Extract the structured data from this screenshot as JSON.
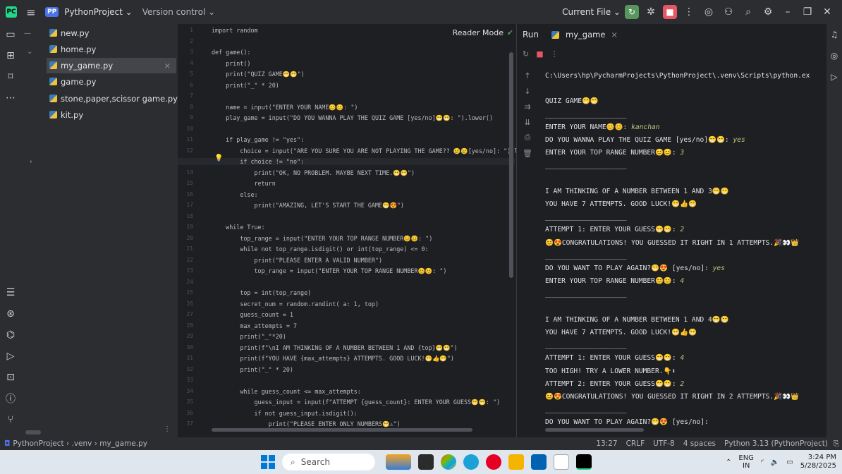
{
  "titlebar": {
    "project_badge": "PP",
    "project_name": "PythonProject ⌄",
    "vcs": "Version control ⌄",
    "run_config": "Current File ⌄"
  },
  "project_tree": [
    {
      "label": "new.py"
    },
    {
      "label": "home.py"
    },
    {
      "label": "my_game.py"
    },
    {
      "label": "game.py"
    },
    {
      "label": "stone,paper,scissor game.py"
    },
    {
      "label": "kit.py"
    }
  ],
  "editor": {
    "reader_mode": "Reader Mode",
    "lines": [
      "import random",
      "",
      "def game():",
      "    print()",
      "    print(\"QUIZ GAME😁😁\")",
      "    print(\"_\" * 20)",
      "",
      "    name = input(\"ENTER YOUR NAME😊😊: \")",
      "    play_game = input(\"DO YOU WANNA PLAY THE QUIZ GAME [yes/no]😁😁: \").lower()",
      "",
      "    if play_game != \"yes\":",
      "        choice = input(\"ARE YOU SURE YOU ARE NOT PLAYING THE GAME?? 😢😢[yes/no]: \").l",
      "        if choice != \"no\":",
      "            print(\"OK, NO PROBLEM. MAYBE NEXT TIME.😁😁\")",
      "            return",
      "        else:",
      "            print(\"AMAZING, LET'S START THE GAME😁😍\")",
      "",
      "    while True:",
      "        top_range = input(\"ENTER YOUR TOP RANGE NUMBER😊😊: \")",
      "        while not top_range.isdigit() or int(top_range) <= 0:",
      "            print(\"PLEASE ENTER A VALID NUMBER\")",
      "            top_range = input(\"ENTER YOUR TOP RANGE NUMBER😊😊: \")",
      "",
      "        top = int(top_range)",
      "        secret_num = random.randint( a: 1, top)",
      "        guess_count = 1",
      "        max_attempts = 7",
      "        print(\"_\"*20)",
      "        print(f\"\\nI AM THINKING OF A NUMBER BETWEEN 1 AND {top}😁😁\")",
      "        print(f\"YOU HAVE {max_attempts} ATTEMPTS. GOOD LUCK!😁👍😁\")",
      "        print(\"_\" * 20)",
      "",
      "        while guess_count <= max_attempts:",
      "            guess_input = input(f\"ATTEMPT {guess_count}: ENTER YOUR GUESS😁😁: \")",
      "            if not guess_input.isdigit():",
      "                print(\"PLEASE ENTER ONLY NUMBERS😁⚠\")"
    ]
  },
  "run": {
    "tab_label": "Run",
    "config_tab": "my_game",
    "output": [
      {
        "t": "C:\\Users\\hp\\PycharmProjects\\PythonProject\\.venv\\Scripts\\python.ex"
      },
      {
        "t": ""
      },
      {
        "t": "QUIZ GAME😁😁"
      },
      {
        "t": "____________________"
      },
      {
        "t": "ENTER YOUR NAME😊😊: ",
        "in": "kanchan"
      },
      {
        "t": "DO YOU WANNA PLAY THE QUIZ GAME [yes/no]😁😁: ",
        "in": "yes"
      },
      {
        "t": "ENTER YOUR TOP RANGE NUMBER😊😊: ",
        "in": "3"
      },
      {
        "t": "____________________"
      },
      {
        "t": ""
      },
      {
        "t": "I AM THINKING OF A NUMBER BETWEEN 1 AND 3😁😁"
      },
      {
        "t": "YOU HAVE 7 ATTEMPTS. GOOD LUCK!😁👍😁"
      },
      {
        "t": "____________________"
      },
      {
        "t": "ATTEMPT 1: ENTER YOUR GUESS😁😁: ",
        "in": "2"
      },
      {
        "t": "😊😍CONGRATULATIONS! YOU GUESSED IT RIGHT IN 1 ATTEMPTS.🎉👀👑"
      },
      {
        "t": "____________________"
      },
      {
        "t": "DO YOU WANT TO PLAY AGAIN?😁😍 [yes/no]: ",
        "in": "yes"
      },
      {
        "t": "ENTER YOUR TOP RANGE NUMBER😊😊: ",
        "in": "4"
      },
      {
        "t": "____________________"
      },
      {
        "t": ""
      },
      {
        "t": "I AM THINKING OF A NUMBER BETWEEN 1 AND 4😁😁"
      },
      {
        "t": "YOU HAVE 7 ATTEMPTS. GOOD LUCK!😁👍😁"
      },
      {
        "t": "____________________"
      },
      {
        "t": "ATTEMPT 1: ENTER YOUR GUESS😁😁: ",
        "in": "4"
      },
      {
        "t": "TOO HIGH! TRY A LOWER NUMBER.👇⬇"
      },
      {
        "t": "ATTEMPT 2: ENTER YOUR GUESS😁😁: ",
        "in": "2"
      },
      {
        "t": "😊😍CONGRATULATIONS! YOU GUESSED IT RIGHT IN 2 ATTEMPTS.🎉👀👑"
      },
      {
        "t": "____________________"
      },
      {
        "t": "DO YOU WANT TO PLAY AGAIN?😁😍 [yes/no]:"
      }
    ]
  },
  "statusbar": {
    "breadcrumb": "PythonProject  ›  .venv  ›  my_game.py",
    "position": "13:27",
    "line_sep": "CRLF",
    "encoding": "UTF-8",
    "indent": "4 spaces",
    "interpreter": "Python 3.13 (PythonProject)"
  },
  "taskbar": {
    "search_placeholder": "Search",
    "lang": "ENG",
    "lang_sub": "IN",
    "time": "3:24 PM",
    "date": "5/28/2025"
  },
  "colors": {
    "accent_green": "#21d789",
    "stop_red": "#e55765",
    "run_green": "#57965c"
  }
}
